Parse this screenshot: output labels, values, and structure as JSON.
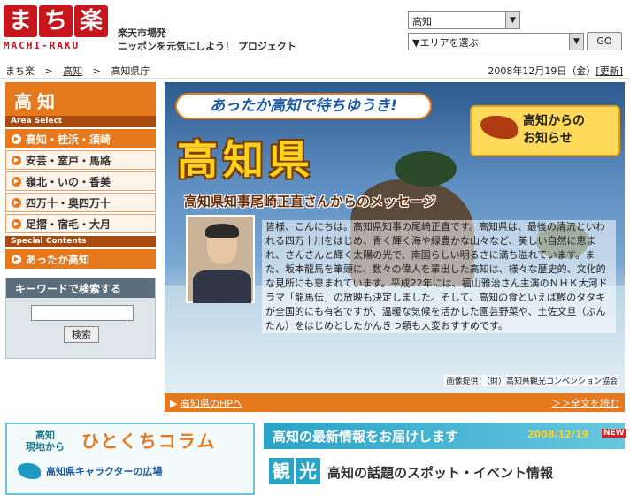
{
  "header": {
    "logo_kanji": [
      "ま",
      "ち",
      "楽"
    ],
    "logo_romaji": "MACHI-RAKU",
    "tagline_line1": "楽天市場発",
    "tagline_line2": "ニッポンを元気にしよう！ プロジェクト",
    "pref_select_value": "高知",
    "area_select_value": "▼エリアを選ぶ",
    "go_label": "GO"
  },
  "breadcrumb": {
    "home": "まち楽",
    "pref": "高知",
    "current": "高知県庁",
    "sep": ">"
  },
  "date_line": {
    "date": "2008年12月19日（金）",
    "update": "[更新]"
  },
  "sidebar": {
    "title": "高知",
    "area_select_label": "Area Select",
    "items": [
      {
        "label": "高知・桂浜・須崎"
      },
      {
        "label": "安芸・室戸・馬路"
      },
      {
        "label": "嶺北・いの・香美"
      },
      {
        "label": "四万十・奥四万十"
      },
      {
        "label": "足摺・宿毛・大月"
      }
    ],
    "special_label": "Special Contents",
    "special_item": "あったか高知"
  },
  "search": {
    "title": "キーワードで検索する",
    "button": "検索"
  },
  "hero": {
    "catch": "あったか高知で待ちゆうき!",
    "title": "高知県",
    "message_title": "高知県知事尾崎正直さんからのメッセージ",
    "notice_line1": "高知からの",
    "notice_line2": "お知らせ",
    "message": "皆様、こんにちは。高知県知事の尾崎正直です。高知県は、最後の清流といわれる四万十川をはじめ、青く輝く海や緑豊かな山々など、美しい自然に恵まれ、さんさんと輝く太陽の光で、南国らしい明るさに満ち溢れています。また、坂本龍馬を筆頭に、数々の偉人を輩出した高知は、様々な歴史的、文化的な見所にも恵まれています。平成22年には、福山雅治さん主演のＮＨＫ大河ドラマ「龍馬伝」の放映も決定しました。そして、高知の食といえば鰹のタタキが全国的にも有名ですが、温暖な気候を活かした園芸野菜や、土佐文旦（ぶんたん）をはじめとしたかんきつ類も大変おすすめです。",
    "credit": "画像提供：（財）高知県観光コンベンション協会",
    "link_left": "高知県のHPへ",
    "link_right": "＞＞全文を読む",
    "bullet": "▶"
  },
  "column": {
    "tag_line1": "高知",
    "tag_line2": "現地から",
    "title": "ひとくちコラム",
    "item": "高知県キャラクターの広場"
  },
  "news": {
    "title": "高知の最新情報をお届けします",
    "date": "2008/12/19",
    "new_badge": "NEW",
    "spot_kanji": [
      "観",
      "光"
    ],
    "spot_title": "高知の話題のスポット・イベント情報"
  },
  "colors": {
    "accent": "#e6781e",
    "brand_red": "#c8161d",
    "teal": "#2aa3c6"
  }
}
